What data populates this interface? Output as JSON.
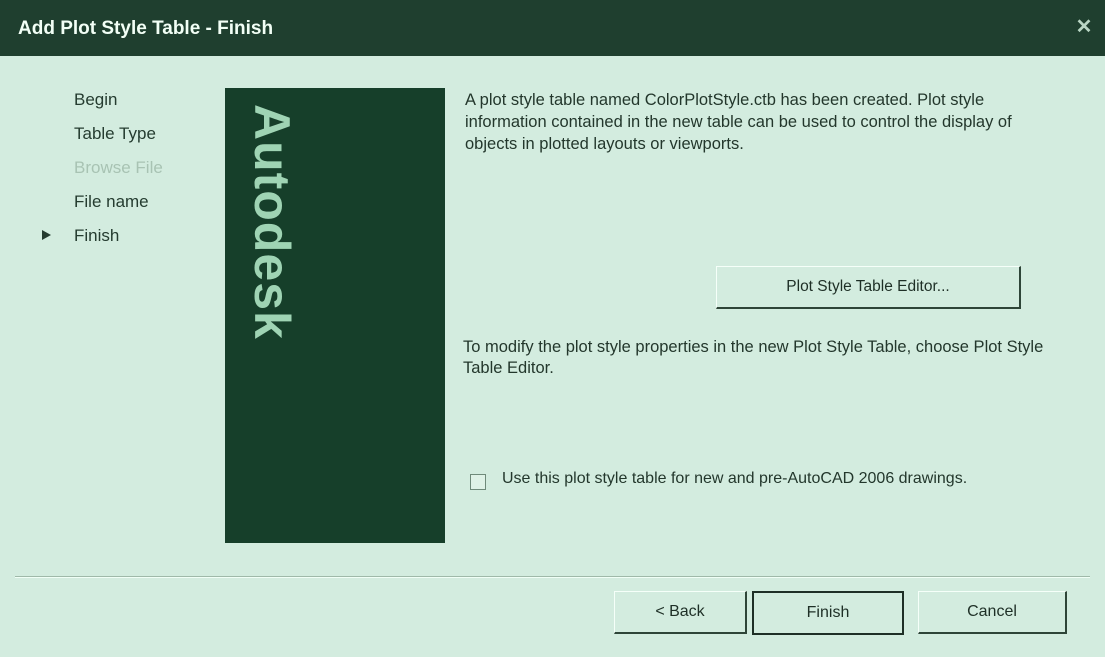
{
  "window": {
    "title": "Add Plot Style Table - Finish",
    "close_glyph": "✕"
  },
  "steps": [
    {
      "label": "Begin"
    },
    {
      "label": "Table Type"
    },
    {
      "label": "Browse File"
    },
    {
      "label": "File name"
    },
    {
      "label": "Finish"
    }
  ],
  "current_step": 4,
  "banner": {
    "brand": "Autodesk"
  },
  "content": {
    "intro": "A plot style table named ColorPlotStyle.ctb has been created. Plot style information contained in the new table can be used to control the display of objects in plotted layouts or viewports.",
    "editor_button": "Plot Style Table Editor...",
    "modify_text": "To modify the plot style properties in the new Plot Style Table, choose Plot Style Table Editor.",
    "use_table_label": "Use this plot style table for new and pre-AutoCAD 2006 drawings.",
    "use_table_checked": false
  },
  "buttons": {
    "back": "< Back",
    "finish": "Finish",
    "cancel": "Cancel"
  }
}
